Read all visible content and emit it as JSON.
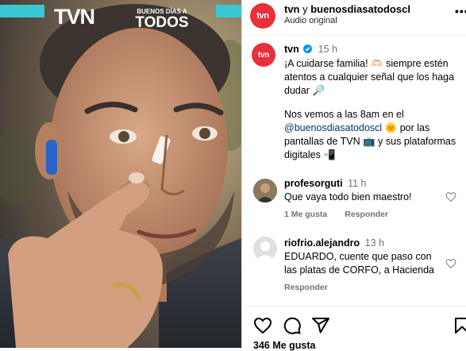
{
  "media": {
    "logo_text": "tvn",
    "show_logo_line1": "BUENOS DÍAS A",
    "show_logo_line2": "TODOS"
  },
  "header": {
    "avatar_text": "tvn",
    "title_user1": "tvn",
    "title_joiner": " y ",
    "title_user2": "buenosdiasatodoscl",
    "subtitle": "Audio original",
    "more_icon": "more-horizontal-icon"
  },
  "caption": {
    "avatar_text": "tvn",
    "username": "tvn",
    "verified_icon": "verified-badge-icon",
    "time": "15 h",
    "line1": "¡A cuidarse familia! 🫶🏻 siempre estén atentos a cualquier señal que los haga dudar 🔎",
    "line2_pre": "Nos vemos a las 8am en el ",
    "line2_mention": "@buenosdiasatodoscl",
    "line2_post": " 🌞 por las pantallas de TVN 📺 y sus plataformas digitales 📲"
  },
  "comments": [
    {
      "username": "profesorguti",
      "time": "11 h",
      "text": "Que vaya todo bien maestro!",
      "likes": "1 Me gusta",
      "reply": "Responder"
    },
    {
      "username": "riofrio.alejandro",
      "time": "13 h",
      "text": "EDUARDO, cuente que paso con las platas de CORFO, a Hacienda",
      "reply": "Responder"
    }
  ],
  "footer": {
    "likes": "346 Me gusta",
    "icons": [
      "heart-icon",
      "comment-icon",
      "share-icon",
      "bookmark-icon"
    ]
  },
  "colors": {
    "tvn_red": "#e8303a",
    "verified_blue": "#0095f6",
    "link": "#00376b",
    "muted": "#737373"
  }
}
